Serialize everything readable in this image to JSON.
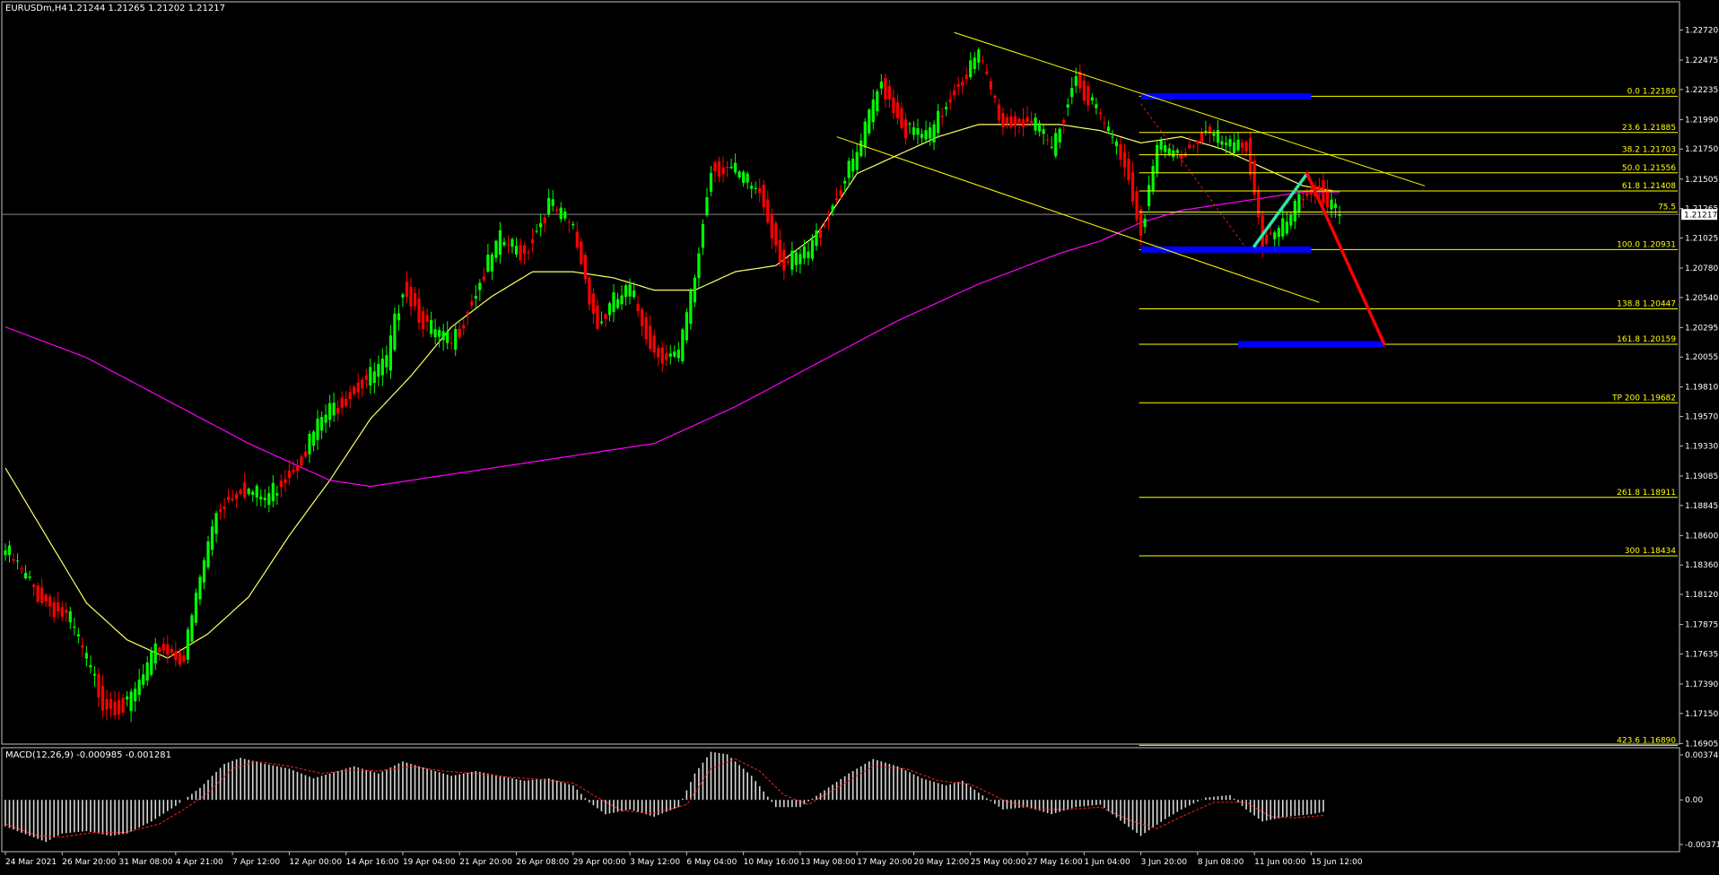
{
  "header": {
    "symbol_label": "EURUSDm,H4",
    "ohlc_label": "1.21244 1.21265 1.21202 1.21217"
  },
  "colors": {
    "background": "#000000",
    "bull_candle": "#00ff00",
    "bear_candle": "#ff0000",
    "ma_slow": "#ff00ff",
    "ma_fast": "#ffff66",
    "fib": "#ffff00",
    "zone": "#0000ff",
    "arrow_up": "#2ee6a8",
    "arrow_down": "#ff0000",
    "frame": "#c0c0c0",
    "text": "#ffffff"
  },
  "chart_data": [
    {
      "type": "candlestick",
      "symbol": "EURUSDm",
      "timeframe": "H4",
      "ylim": [
        1.169,
        1.2295
      ],
      "price_axis_ticks": [
        "1.22720",
        "1.22475",
        "1.22235",
        "1.21990",
        "1.21750",
        "1.21505",
        "1.21265",
        "1.21025",
        "1.20780",
        "1.20540",
        "1.20295",
        "1.20055",
        "1.19810",
        "1.19570",
        "1.19330",
        "1.19085",
        "1.18845",
        "1.18600",
        "1.18360",
        "1.18120",
        "1.17875",
        "1.17635",
        "1.17390",
        "1.17150",
        "1.16905"
      ],
      "price_axis_values": [
        1.2272,
        1.22475,
        1.22235,
        1.2199,
        1.2175,
        1.21505,
        1.21265,
        1.21025,
        1.2078,
        1.2054,
        1.20295,
        1.20055,
        1.1981,
        1.1957,
        1.1933,
        1.19085,
        1.18845,
        1.186,
        1.1836,
        1.1812,
        1.17875,
        1.17635,
        1.1739,
        1.1715,
        1.16905
      ],
      "current_price_label": "1.21217",
      "current_price": 1.21217,
      "time_labels": [
        "24 Mar 2021",
        "26 Mar 20:00",
        "31 Mar 08:00",
        "4 Apr 21:00",
        "7 Apr 12:00",
        "12 Apr 00:00",
        "14 Apr 16:00",
        "19 Apr 04:00",
        "21 Apr 20:00",
        "26 Apr 08:00",
        "29 Apr 00:00",
        "3 May 12:00",
        "6 May 04:00",
        "10 May 16:00",
        "13 May 08:00",
        "17 May 20:00",
        "20 May 12:00",
        "25 May 00:00",
        "27 May 16:00",
        "1 Jun 04:00",
        "3 Jun 20:00",
        "8 Jun 08:00",
        "11 Jun 00:00",
        "15 Jun 12:00"
      ],
      "time_label_index": [
        0,
        14,
        28,
        42,
        56,
        70,
        84,
        98,
        112,
        126,
        140,
        154,
        168,
        182,
        196,
        210,
        224,
        238,
        252,
        266,
        280,
        294,
        308,
        322
      ],
      "close_path": {
        "bars": 330,
        "anchors": [
          [
            0,
            1.1848
          ],
          [
            8,
            1.1812
          ],
          [
            16,
            1.179
          ],
          [
            24,
            1.1725
          ],
          [
            30,
            1.172
          ],
          [
            38,
            1.177
          ],
          [
            44,
            1.176
          ],
          [
            48,
            1.1825
          ],
          [
            52,
            1.188
          ],
          [
            58,
            1.19
          ],
          [
            64,
            1.189
          ],
          [
            72,
            1.192
          ],
          [
            78,
            1.1955
          ],
          [
            86,
            1.198
          ],
          [
            94,
            1.2
          ],
          [
            98,
            1.2065
          ],
          [
            104,
            1.203
          ],
          [
            110,
            1.2015
          ],
          [
            116,
            1.206
          ],
          [
            122,
            1.21
          ],
          [
            128,
            1.209
          ],
          [
            134,
            1.213
          ],
          [
            140,
            1.211
          ],
          [
            146,
            1.203
          ],
          [
            150,
            1.205
          ],
          [
            154,
            1.206
          ],
          [
            160,
            1.201
          ],
          [
            166,
            1.2005
          ],
          [
            170,
            1.207
          ],
          [
            174,
            1.216
          ],
          [
            178,
            1.216
          ],
          [
            186,
            1.214
          ],
          [
            192,
            1.208
          ],
          [
            198,
            1.209
          ],
          [
            204,
            1.213
          ],
          [
            210,
            1.217
          ],
          [
            216,
            1.223
          ],
          [
            222,
            1.219
          ],
          [
            228,
            1.2185
          ],
          [
            234,
            1.2225
          ],
          [
            240,
            1.225
          ],
          [
            246,
            1.2195
          ],
          [
            252,
            1.22
          ],
          [
            258,
            1.2175
          ],
          [
            264,
            1.2235
          ],
          [
            270,
            1.22
          ],
          [
            276,
            1.2165
          ],
          [
            280,
            1.211
          ],
          [
            284,
            1.2175
          ],
          [
            290,
            1.217
          ],
          [
            296,
            1.219
          ],
          [
            302,
            1.2175
          ],
          [
            306,
            1.218
          ],
          [
            310,
            1.21
          ],
          [
            314,
            1.2105
          ],
          [
            320,
            1.2135
          ],
          [
            324,
            1.2145
          ],
          [
            326,
            1.213
          ],
          [
            329,
            1.21217
          ]
        ]
      },
      "moving_averages": [
        {
          "anchors": [
            [
              0,
              1.1915
            ],
            [
              10,
              1.186
            ],
            [
              20,
              1.1805
            ],
            [
              30,
              1.1775
            ],
            [
              40,
              1.176
            ],
            [
              50,
              1.178
            ],
            [
              60,
              1.181
            ],
            [
              70,
              1.186
            ],
            [
              80,
              1.1905
            ],
            [
              90,
              1.1955
            ],
            [
              100,
              1.199
            ],
            [
              110,
              1.203
            ],
            [
              120,
              1.2055
            ],
            [
              130,
              1.2075
            ],
            [
              140,
              1.2075
            ],
            [
              150,
              1.207
            ],
            [
              160,
              1.206
            ],
            [
              170,
              1.206
            ],
            [
              180,
              1.2075
            ],
            [
              190,
              1.208
            ],
            [
              200,
              1.2105
            ],
            [
              210,
              1.2155
            ],
            [
              220,
              1.217
            ],
            [
              230,
              1.2185
            ],
            [
              240,
              1.2195
            ],
            [
              250,
              1.2195
            ],
            [
              260,
              1.2195
            ],
            [
              270,
              1.219
            ],
            [
              280,
              1.218
            ],
            [
              290,
              1.2185
            ],
            [
              300,
              1.2175
            ],
            [
              310,
              1.216
            ],
            [
              320,
              1.2145
            ],
            [
              329,
              1.214
            ]
          ]
        },
        {
          "anchors": [
            [
              0,
              1.203
            ],
            [
              20,
              1.2005
            ],
            [
              40,
              1.197
            ],
            [
              60,
              1.1935
            ],
            [
              70,
              1.192
            ],
            [
              80,
              1.1905
            ],
            [
              90,
              1.19
            ],
            [
              100,
              1.1905
            ],
            [
              120,
              1.1915
            ],
            [
              140,
              1.1925
            ],
            [
              160,
              1.1935
            ],
            [
              180,
              1.1965
            ],
            [
              200,
              1.2
            ],
            [
              220,
              1.2035
            ],
            [
              240,
              1.2065
            ],
            [
              260,
              1.209
            ],
            [
              270,
              1.21
            ],
            [
              280,
              1.2115
            ],
            [
              290,
              1.2125
            ],
            [
              300,
              1.213
            ],
            [
              310,
              1.2135
            ],
            [
              320,
              1.214
            ],
            [
              329,
              1.214
            ]
          ]
        }
      ],
      "fibonacci_levels": [
        {
          "label": "0.0 1.22180",
          "price": 1.2218
        },
        {
          "label": "23.6 1.21885",
          "price": 1.21885
        },
        {
          "label": "38.2 1.21703",
          "price": 1.21703
        },
        {
          "label": "50.0 1.21556",
          "price": 1.21556
        },
        {
          "label": "61.8 1.21408",
          "price": 1.21408
        },
        {
          "label": "75.5",
          "price": 1.21237
        },
        {
          "label": "100.0 1.20931",
          "price": 1.20931
        },
        {
          "label": "138.8 1.20447",
          "price": 1.20447
        },
        {
          "label": "161.8 1.20159",
          "price": 1.20159
        },
        {
          "label": "TP 200 1.19682",
          "price": 1.19682
        },
        {
          "label": "261.8 1.18911",
          "price": 1.18911
        },
        {
          "label": "300 1.18434",
          "price": 1.18434
        },
        {
          "label": "423.6 1.16890",
          "price": 1.1689
        }
      ],
      "zones": [
        {
          "price": 1.2218,
          "from_bar": 280,
          "to_bar": 322
        },
        {
          "price": 1.20931,
          "from_bar": 280,
          "to_bar": 322
        },
        {
          "price": 1.20159,
          "from_bar": 304,
          "to_bar": 340
        }
      ],
      "trendlines": [
        {
          "from": [
            234,
            1.227
          ],
          "to": [
            350,
            1.2145
          ]
        },
        {
          "from": [
            205,
            1.2185
          ],
          "to": [
            324,
            1.205
          ]
        }
      ],
      "projection_arrows": [
        {
          "role": "up",
          "from": [
            308,
            1.2096
          ],
          "to": [
            321,
            1.2155
          ]
        },
        {
          "role": "down",
          "from": [
            321,
            1.2155
          ],
          "to": [
            340,
            1.2016
          ]
        }
      ]
    },
    {
      "type": "histogram",
      "indicator_label": "MACD(12,26,9) -0.000985 -0.001281",
      "ylim": [
        -0.003719,
        0.003749
      ],
      "axis_ticks": [
        "0.003749",
        "0.00",
        "-0.003719"
      ],
      "axis_values": [
        0.003749,
        0,
        -0.003719
      ],
      "histogram_anchors": [
        [
          0,
          -0.0022
        ],
        [
          6,
          -0.003
        ],
        [
          10,
          -0.0035
        ],
        [
          14,
          -0.0028
        ],
        [
          20,
          -0.0026
        ],
        [
          26,
          -0.003
        ],
        [
          30,
          -0.0028
        ],
        [
          36,
          -0.0018
        ],
        [
          42,
          -0.0005
        ],
        [
          48,
          0.001
        ],
        [
          54,
          0.003
        ],
        [
          58,
          0.0035
        ],
        [
          64,
          0.003
        ],
        [
          70,
          0.0026
        ],
        [
          76,
          0.0018
        ],
        [
          80,
          0.0022
        ],
        [
          86,
          0.0028
        ],
        [
          92,
          0.0022
        ],
        [
          98,
          0.0032
        ],
        [
          104,
          0.0026
        ],
        [
          110,
          0.002
        ],
        [
          116,
          0.0024
        ],
        [
          122,
          0.002
        ],
        [
          128,
          0.0016
        ],
        [
          134,
          0.0018
        ],
        [
          140,
          0.0012
        ],
        [
          144,
          -0.0002
        ],
        [
          148,
          -0.0012
        ],
        [
          154,
          -0.0008
        ],
        [
          160,
          -0.0014
        ],
        [
          166,
          -0.0006
        ],
        [
          170,
          0.0022
        ],
        [
          174,
          0.004
        ],
        [
          178,
          0.0038
        ],
        [
          184,
          0.002
        ],
        [
          190,
          -0.0006
        ],
        [
          196,
          -0.0006
        ],
        [
          202,
          0.0008
        ],
        [
          208,
          0.0022
        ],
        [
          214,
          0.0034
        ],
        [
          220,
          0.0028
        ],
        [
          226,
          0.0018
        ],
        [
          232,
          0.0012
        ],
        [
          236,
          0.0016
        ],
        [
          240,
          0.0006
        ],
        [
          246,
          -0.0008
        ],
        [
          252,
          -0.0006
        ],
        [
          258,
          -0.0012
        ],
        [
          264,
          -0.0006
        ],
        [
          270,
          -0.0004
        ],
        [
          276,
          -0.002
        ],
        [
          280,
          -0.003
        ],
        [
          286,
          -0.0016
        ],
        [
          290,
          -0.0008
        ],
        [
          296,
          0.0002
        ],
        [
          302,
          0.0004
        ],
        [
          306,
          -0.0008
        ],
        [
          310,
          -0.0018
        ],
        [
          316,
          -0.0014
        ],
        [
          322,
          -0.0012
        ],
        [
          325,
          -0.001
        ]
      ],
      "signal_anchors": [
        [
          0,
          -0.002
        ],
        [
          8,
          -0.003
        ],
        [
          14,
          -0.0031
        ],
        [
          22,
          -0.0027
        ],
        [
          30,
          -0.0027
        ],
        [
          38,
          -0.002
        ],
        [
          44,
          -0.0008
        ],
        [
          50,
          0.0006
        ],
        [
          56,
          0.0026
        ],
        [
          62,
          0.0032
        ],
        [
          70,
          0.0028
        ],
        [
          78,
          0.0022
        ],
        [
          86,
          0.0025
        ],
        [
          92,
          0.0024
        ],
        [
          100,
          0.0028
        ],
        [
          108,
          0.0024
        ],
        [
          116,
          0.0022
        ],
        [
          124,
          0.0019
        ],
        [
          132,
          0.0017
        ],
        [
          140,
          0.0014
        ],
        [
          146,
          0.0002
        ],
        [
          152,
          -0.0009
        ],
        [
          160,
          -0.0011
        ],
        [
          168,
          -0.0004
        ],
        [
          174,
          0.0026
        ],
        [
          180,
          0.0034
        ],
        [
          186,
          0.0024
        ],
        [
          192,
          0.0004
        ],
        [
          198,
          -0.0004
        ],
        [
          206,
          0.0012
        ],
        [
          214,
          0.0028
        ],
        [
          222,
          0.0026
        ],
        [
          230,
          0.0016
        ],
        [
          238,
          0.0013
        ],
        [
          246,
          0.0
        ],
        [
          254,
          -0.0008
        ],
        [
          262,
          -0.0008
        ],
        [
          270,
          -0.0006
        ],
        [
          278,
          -0.0018
        ],
        [
          284,
          -0.0024
        ],
        [
          290,
          -0.0014
        ],
        [
          298,
          -0.0002
        ],
        [
          306,
          -0.0002
        ],
        [
          312,
          -0.0014
        ],
        [
          318,
          -0.0015
        ],
        [
          325,
          -0.0013
        ]
      ]
    }
  ]
}
